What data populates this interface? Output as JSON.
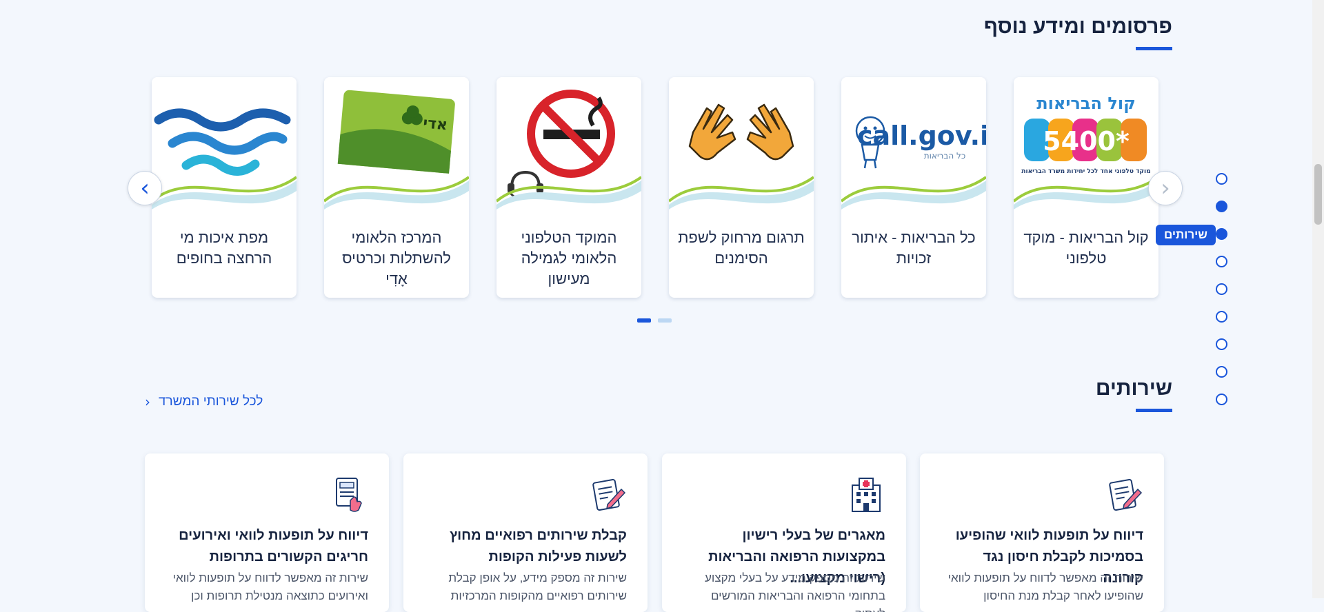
{
  "publications": {
    "title": "פרסומים ומידע נוסף",
    "cards": [
      {
        "title": "קול הבריאות - מוקד טלפוני",
        "image": "kol-habriut-5400-logo",
        "img_text_top": "קול הבריאות",
        "img_number": "*5400",
        "img_caption": "מוקד טלפוני אחד לכל יחידות משרד הבריאות"
      },
      {
        "title": "כל הבריאות - איתור זכויות",
        "image": "call-gov-il-logo",
        "img_text_top": "call.gov.il",
        "img_caption": "כל הבריאות"
      },
      {
        "title": "תרגום מרחוק לשפת הסימנים",
        "image": "sign-language-hands-icon"
      },
      {
        "title": "המוקד הטלפוני הלאומי לגמילה מעישון",
        "image": "no-smoking-headset-icon"
      },
      {
        "title": "המרכז הלאומי להשתלות וכרטיס אָדִי",
        "image": "adi-card-image",
        "img_card_name": "אדי"
      },
      {
        "title": "מפת איכות מי הרחצה בחופים",
        "image": "sea-waves-icon"
      }
    ],
    "prev_arrow": "‹",
    "next_arrow": "›",
    "pager": {
      "count": 2,
      "active_index": 1
    }
  },
  "section_nav": {
    "active_label": "שירותים",
    "dots": [
      {
        "state": "empty"
      },
      {
        "state": "filled"
      },
      {
        "state": "filled"
      },
      {
        "state": "empty"
      },
      {
        "state": "empty"
      },
      {
        "state": "empty"
      },
      {
        "state": "empty"
      },
      {
        "state": "empty"
      },
      {
        "state": "empty"
      }
    ]
  },
  "services": {
    "title": "שירותים",
    "all_link": "לכל שירותי המשרד",
    "all_link_icon": "chevron-left-icon",
    "cards": [
      {
        "icon": "document-pen-icon",
        "title": "דיווח על תופעות לוואי שהופיעו בסמיכות לקבלת חיסון נגד קורונה",
        "desc": "שירות זה מאפשר לדווח על תופעות לוואי שהופיעו לאחר קבלת מנת החיסון"
      },
      {
        "icon": "hospital-building-icon",
        "title": "מאגרים של בעלי רישיון במקצועות הרפואה והבריאות (רישוי מקצועו...",
        "desc": "שירות זה מספק מידע על בעלי מקצוע בתחומי הרפואה והבריאות המורשים לעסוק"
      },
      {
        "icon": "document-pen-icon",
        "title": "קבלת שירותים רפואיים מחוץ לשעות פעילות הקופות",
        "desc": "שירות זה מספק מידע, על אופן קבלת שירותים רפואיים מהקופות המרכזיות"
      },
      {
        "icon": "form-hand-icon",
        "title": "דיווח על תופעות לוואי ואירועים חריגים הקשורים בתרופות",
        "desc": "שירות זה מאפשר לדווח על תופעות לוואי ואירועים כתוצאה מנטילת תרופות וכן"
      }
    ]
  },
  "colors": {
    "accent": "#1a56db",
    "heading": "#16233f",
    "background": "#f3f7fd"
  }
}
